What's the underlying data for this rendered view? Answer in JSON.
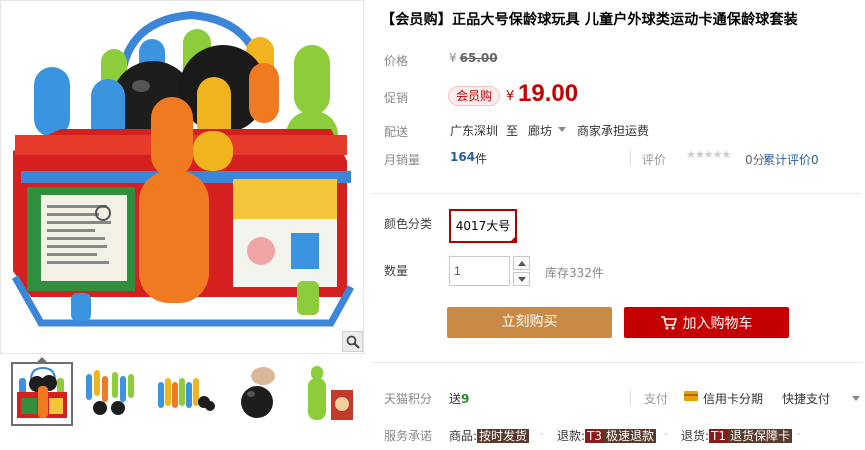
{
  "title": "【会员购】正品大号保龄球玩具 儿童户外球类运动卡通保龄球套装",
  "price": {
    "label": "价格",
    "currency": "¥",
    "original": "65.00"
  },
  "promo": {
    "label": "促销",
    "badge": "会员购",
    "currency": "¥",
    "price": "19.00"
  },
  "shipping": {
    "label": "配送",
    "from": "广东深圳",
    "to_word": "至",
    "to": "廊坊",
    "fee": "商家承担运费"
  },
  "sales": {
    "label": "月销量",
    "count": "164",
    "unit": "件"
  },
  "rating": {
    "label": "评价",
    "stars": "★★★★★",
    "score": "0分",
    "link": "累计评价0"
  },
  "sku": {
    "label": "颜色分类",
    "option": "4017大号"
  },
  "quantity": {
    "label": "数量",
    "value": "1",
    "stock": "库存332件"
  },
  "buttons": {
    "buy": "立刻购买",
    "cart": "加入购物车"
  },
  "points": {
    "label": "天猫积分",
    "prefix": "送",
    "value": "9"
  },
  "payment": {
    "label": "支付",
    "card": "信用卡分期",
    "quick": "快捷支付"
  },
  "service": {
    "label": "服务承诺",
    "items": [
      {
        "prefix": "商品:",
        "tag": "按时发货"
      },
      {
        "prefix": "退款:",
        "tag_code": "T3",
        "tag": "极速退款"
      },
      {
        "prefix": "退货:",
        "tag_code": "T1",
        "tag": "退货保障卡"
      }
    ]
  },
  "gallery": {
    "icons": [
      "zoom-icon"
    ],
    "thumb_count": 5
  },
  "colors": {
    "accent_red": "#c40000",
    "buy_orange": "#c98a45",
    "link_blue": "#2b5f9e"
  }
}
